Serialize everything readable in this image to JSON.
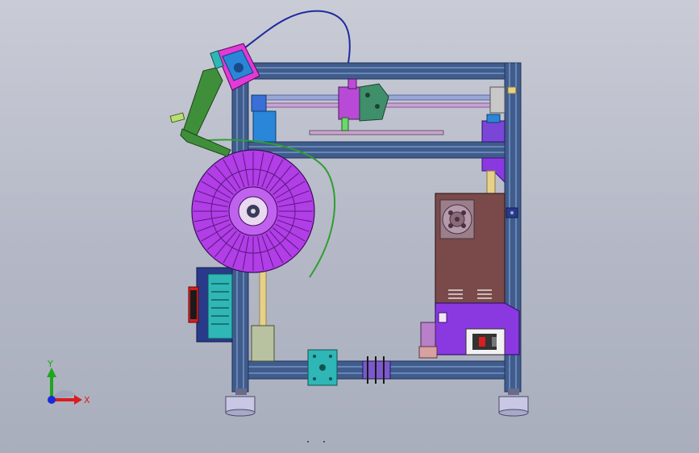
{
  "triad": {
    "x_label": "X",
    "y_label": "Y",
    "x_color": "#d81e1e",
    "y_color": "#1fa51f",
    "z_color": "#1a2ad8"
  },
  "model": {
    "frame_color": "#3f5c8c",
    "spool_color": "#b13ee6",
    "psu_color": "#7a4a4a",
    "fan_color": "#9a7f8a",
    "bracket_color": "#8a39e0",
    "extruder_arm_color": "#3f8f3a",
    "filament_color": "#2f9e2f",
    "cable_color": "#1f2a9e",
    "board_color": "#2fb6b6",
    "motor_color": "#2a86d8",
    "foot_color": "#c8c8e4",
    "rod_color": "#e6d08a"
  },
  "icons": {
    "view_triad": "view-triad-icon"
  }
}
